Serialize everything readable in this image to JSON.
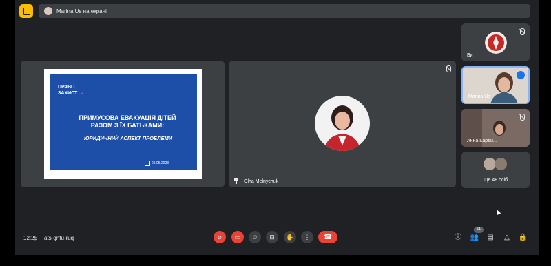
{
  "presenting_text": "Marina Us на екрані",
  "slide": {
    "logo_line1": "ПРАВО",
    "logo_line2": "ЗАХИСТ",
    "logo_small": "Lab",
    "title": "ПРИМУСОВА ЕВАКУАЦІЯ ДІТЕЙ РАЗОМ З ЇХ БАТЬКАМИ:",
    "subtitle": "ЮРИДИЧНИЙ АСПЕКТ ПРОБЛЕМИ",
    "date": "25.05.2023"
  },
  "main_speaker": {
    "name": "Olha Melnychuk"
  },
  "side_tiles": [
    {
      "name": "Ви"
    },
    {
      "name": "Marina Us"
    },
    {
      "name": "Анна Карди..."
    },
    {
      "name": "Ще 48 осіб"
    }
  ],
  "bottom_bar": {
    "time": "12:25",
    "meeting_code": "ats-gnfu-ruq",
    "participants_count": "51"
  },
  "colors": {
    "accent_red": "#ea4335",
    "bg": "#202124",
    "tile": "#3c4043",
    "highlight_blue": "#8ab4f8"
  },
  "icons": [
    "present-off-icon",
    "mic-off-icon",
    "camera-off-icon",
    "emoji-icon",
    "present-icon",
    "raise-hand-icon",
    "more-icon",
    "end-call-icon",
    "info-icon",
    "people-icon",
    "chat-icon",
    "activities-icon",
    "lock-icon"
  ]
}
